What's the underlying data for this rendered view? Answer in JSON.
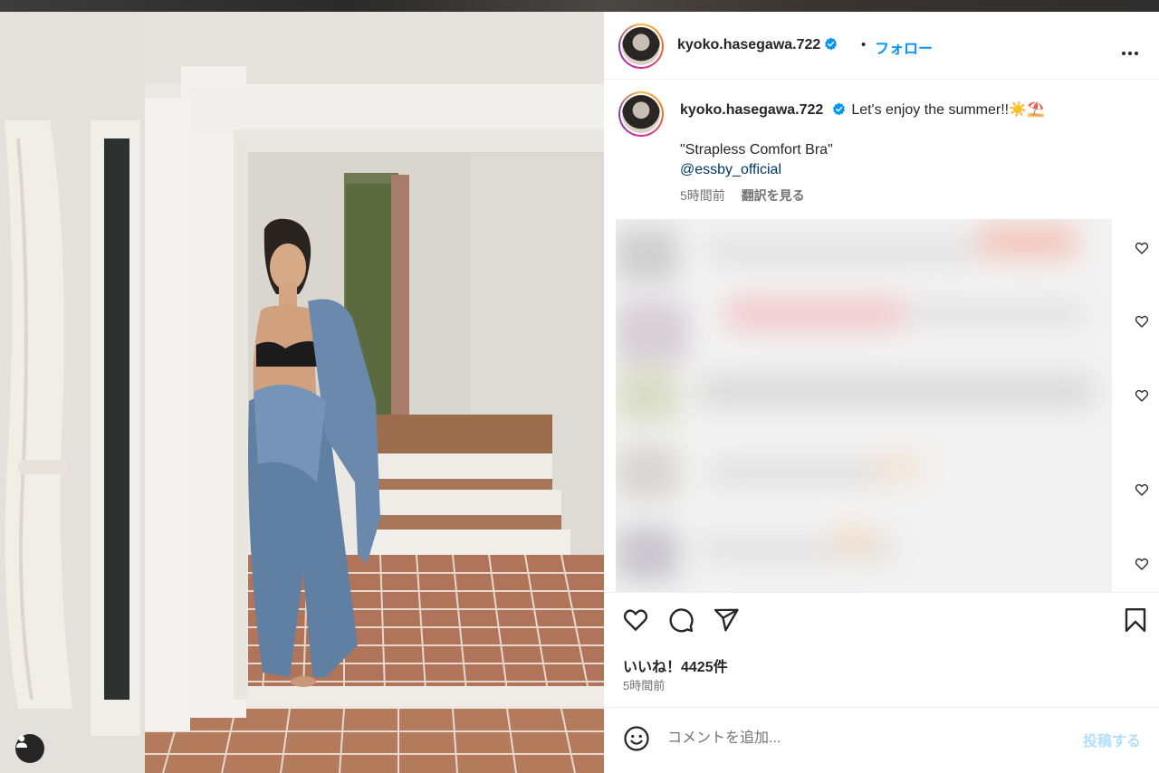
{
  "post": {
    "username": "kyoko.hasegawa.722",
    "follow_label": "フォロー",
    "separator": "•",
    "caption": {
      "text": "Let's enjoy the summer!!☀️⛱️",
      "line2": "\"Strapless Comfort Bra\"",
      "mention": "@essby_official"
    },
    "caption_time": "5時間前",
    "translate_label": "翻訳を見る",
    "likes": "いいね！4425件",
    "time": "5時間前"
  },
  "comment_box": {
    "placeholder": "コメントを追加...",
    "post_label": "投稿する"
  },
  "colors": {
    "accent": "#0095f6",
    "verified": "#0095f6",
    "mention": "#00376b",
    "muted": "#737373",
    "post_disabled": "#b2dffc"
  },
  "icons": {
    "photo_tag": "user-tag-icon",
    "more": "more-options-icon",
    "like": "heart-icon",
    "comment": "comment-icon",
    "share": "share-icon",
    "save": "bookmark-icon",
    "emoji": "emoji-icon"
  }
}
